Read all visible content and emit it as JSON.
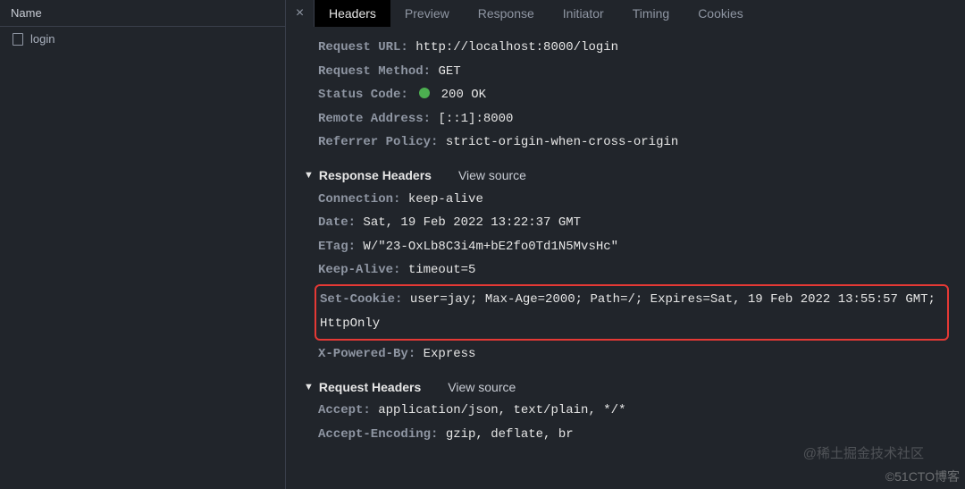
{
  "sidebar": {
    "header": "Name",
    "items": [
      {
        "label": "login"
      }
    ]
  },
  "tabs": {
    "close": "×",
    "list": [
      {
        "label": "Headers",
        "active": true
      },
      {
        "label": "Preview"
      },
      {
        "label": "Response"
      },
      {
        "label": "Initiator"
      },
      {
        "label": "Timing"
      },
      {
        "label": "Cookies"
      }
    ]
  },
  "general": {
    "request_url_k": "Request URL:",
    "request_url_v": "http://localhost:8000/login",
    "method_k": "Request Method:",
    "method_v": "GET",
    "status_k": "Status Code:",
    "status_v": "200 OK",
    "remote_k": "Remote Address:",
    "remote_v": "[::1]:8000",
    "referrer_k": "Referrer Policy:",
    "referrer_v": "strict-origin-when-cross-origin"
  },
  "response": {
    "title": "Response Headers",
    "view_source": "View source",
    "connection_k": "Connection:",
    "connection_v": "keep-alive",
    "date_k": "Date:",
    "date_v": "Sat, 19 Feb 2022 13:22:37 GMT",
    "etag_k": "ETag:",
    "etag_v": "W/\"23-OxLb8C3i4m+bE2fo0Td1N5MvsHc\"",
    "keepalive_k": "Keep-Alive:",
    "keepalive_v": "timeout=5",
    "setcookie_k": "Set-Cookie:",
    "setcookie_v": "user=jay; Max-Age=2000; Path=/; Expires=Sat, 19 Feb 2022 13:55:57 GMT; HttpOnly",
    "xpowered_k": "X-Powered-By:",
    "xpowered_v": "Express"
  },
  "request": {
    "title": "Request Headers",
    "view_source": "View source",
    "accept_k": "Accept:",
    "accept_v": "application/json, text/plain, */*",
    "acceptenc_k": "Accept-Encoding:",
    "acceptenc_v": "gzip, deflate, br"
  },
  "watermark1": "@稀土掘金技术社区",
  "watermark2": "©51CTO博客"
}
